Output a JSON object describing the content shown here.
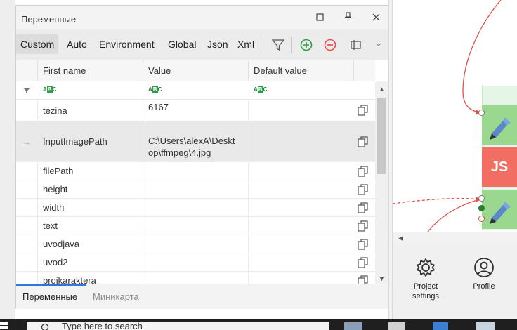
{
  "panel": {
    "title": "Переменные",
    "tabs": [
      "Custom",
      "Auto",
      "Environment",
      "Global",
      "Json",
      "Xml"
    ],
    "active_tab": "Custom"
  },
  "grid": {
    "columns": [
      "First name",
      "Value",
      "Default value"
    ],
    "filter_glyph": [
      "A",
      "B",
      "C"
    ],
    "rows": [
      {
        "name": "tezina",
        "value": "6167",
        "default": ""
      },
      {
        "name": "InputImagePath",
        "value_line1": "C:\\Users\\alexA\\Deskt",
        "value_line2": "op\\ffmpeg\\4.jpg",
        "default": ""
      },
      {
        "name": "filePath",
        "value": "",
        "default": ""
      },
      {
        "name": "height",
        "value": "",
        "default": ""
      },
      {
        "name": "width",
        "value": "",
        "default": ""
      },
      {
        "name": "text",
        "value": "",
        "default": ""
      },
      {
        "name": "uvodjava",
        "value": "",
        "default": ""
      },
      {
        "name": "uvod2",
        "value": "",
        "default": ""
      },
      {
        "name": "brojkaraktera",
        "value": "",
        "default": ""
      }
    ],
    "selected_row": 1
  },
  "bottom_tabs": [
    "Переменные",
    "Миникарта"
  ],
  "canvas": {
    "js_label": "JS"
  },
  "sidebar": {
    "project_settings_line1": "Project",
    "project_settings_line2": "settings",
    "profile": "Profile"
  },
  "taskbar": {
    "search_text": "Type here to search"
  },
  "colors": {
    "accent": "#2b79d6",
    "green_node": "#9bd88f",
    "js_node": "#f26d62",
    "connector": "#e0504a",
    "add": "#2e9e44",
    "remove": "#e0504a"
  }
}
